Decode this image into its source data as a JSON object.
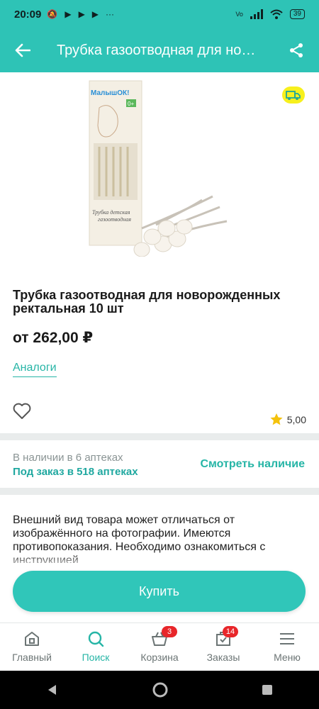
{
  "status_bar": {
    "time": "20:09",
    "battery": "39"
  },
  "app_bar": {
    "title": "Трубка газоотводная для но…"
  },
  "product": {
    "image_text": {
      "brand": "МалышОК!",
      "age": "0+",
      "box_caption_line1": "Трубка детская",
      "box_caption_line2": "газоотводная"
    },
    "title": "Трубка газоотводная для новорожденных ректальная 10 шт",
    "price": "от 262,00 ₽",
    "analogs_label": "Аналоги",
    "rating": "5,00"
  },
  "availability": {
    "in_stock": "В наличии в 6 аптеках",
    "on_order": "Под заказ в 518 аптеках",
    "see_link": "Смотреть наличие"
  },
  "description": "Внешний вид товара может отличаться от изображённого на фотографии. Имеются противопоказания. Необходимо ознакомиться с инструкцией",
  "buy_button": "Купить",
  "bottom_nav": {
    "items": [
      {
        "label": "Главный",
        "icon": "home-icon"
      },
      {
        "label": "Поиск",
        "icon": "search-icon",
        "active": true
      },
      {
        "label": "Корзина",
        "icon": "basket-icon",
        "badge": "3"
      },
      {
        "label": "Заказы",
        "icon": "orders-icon",
        "badge": "14"
      },
      {
        "label": "Меню",
        "icon": "menu-icon"
      }
    ]
  },
  "colors": {
    "accent": "#2ec3b6",
    "badge": "#e8262a",
    "delivery_badge": "#f7f01d"
  }
}
